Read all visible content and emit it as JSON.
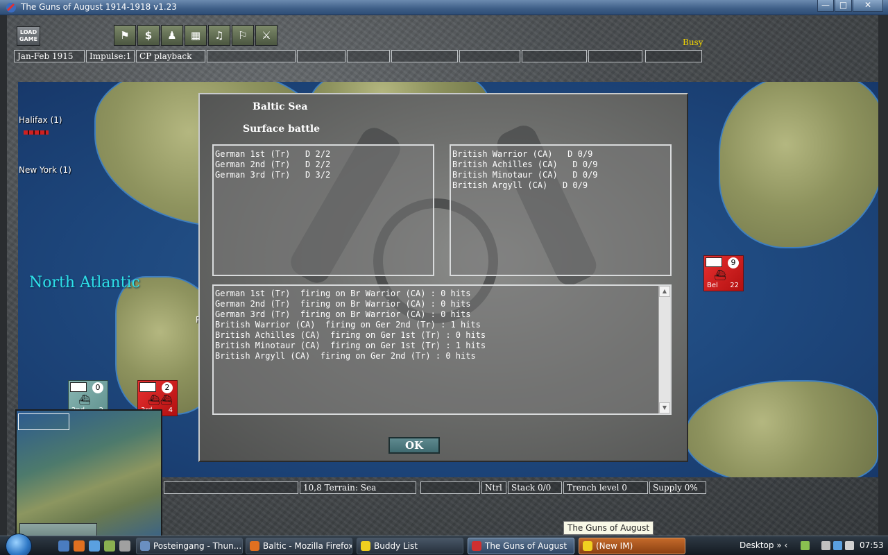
{
  "window": {
    "title": "The Guns of August 1914-1918  v1.23",
    "min_label": "—",
    "max_label": "□",
    "close_label": "✕"
  },
  "toolbar": {
    "load_game_label": "LOAD GAME",
    "tools": [
      {
        "icon": "map-flag-icon",
        "glyph": "⚑"
      },
      {
        "icon": "dollar-icon",
        "glyph": "$"
      },
      {
        "icon": "soldier-icon",
        "glyph": "♟"
      },
      {
        "icon": "map-icon",
        "glyph": "▦"
      },
      {
        "icon": "gramophone-icon",
        "glyph": "♫"
      },
      {
        "icon": "flag-icon",
        "glyph": "⚐"
      },
      {
        "icon": "troops-icon",
        "glyph": "⚔"
      }
    ],
    "busy": "Busy"
  },
  "status": {
    "date": "Jan-Feb 1915",
    "impulse": "Impulse:1",
    "phase": "CP playback",
    "empty": ""
  },
  "map": {
    "cities": [
      "Halifax (1)",
      "New York (1)"
    ],
    "ocean": "North Atlantic",
    "partial_label": "Ph",
    "units": [
      {
        "id": "british-fleet-right",
        "number": "9",
        "label": "Bel",
        "strength": "22"
      },
      {
        "id": "german-fleet",
        "number": "0",
        "label": "2nd",
        "strength": "2"
      },
      {
        "id": "british-fleet-left",
        "number": "2",
        "label": "3rd",
        "strength": "4"
      }
    ]
  },
  "dialog": {
    "title": "Baltic Sea",
    "subtitle": "Surface battle",
    "german_units": [
      "German 1st (Tr)   D 2/2",
      "German 2nd (Tr)   D 2/2",
      "German 3rd (Tr)   D 3/2"
    ],
    "british_units": [
      "British Warrior (CA)   D 0/9",
      "British Achilles (CA)   D 0/9",
      "British Minotaur (CA)   D 0/9",
      "British Argyll (CA)   D 0/9"
    ],
    "log": [
      "German 1st (Tr)  firing on Br Warrior (CA) : 0 hits",
      "German 2nd (Tr)  firing on Br Warrior (CA) : 0 hits",
      "German 3rd (Tr)  firing on Br Warrior (CA) : 0 hits",
      "British Warrior (CA)  firing on Ger 2nd (Tr) : 1 hits",
      "British Achilles (CA)  firing on Ger 1st (Tr) : 0 hits",
      "British Minotaur (CA)  firing on Ger 1st (Tr) : 1 hits",
      "British Argyll (CA)  firing on Ger 2nd (Tr) : 0 hits"
    ],
    "ok_label": "OK"
  },
  "bottom_status": {
    "coords": "10,8  Terrain: Sea",
    "nation": "Ntrl",
    "stack": "Stack 0/0",
    "trench": "Trench level 0",
    "supply": "Supply 0%"
  },
  "tooltip": "The Guns of August",
  "taskbar": {
    "tasks": [
      {
        "label": "Posteingang - Thun...",
        "icon_color": "#6a8fc0"
      },
      {
        "label": "Baltic - Mozilla Firefox",
        "icon_color": "#e07020"
      },
      {
        "label": "Buddy List",
        "icon_color": "#f0d020"
      },
      {
        "label": "The Guns of August",
        "icon_color": "#d03030"
      },
      {
        "label": "(New IM)",
        "icon_color": "#f0d020"
      }
    ],
    "desktop": "Desktop",
    "tray_chevrons": "»  ‹",
    "clock": "07:53"
  },
  "colors": {
    "busy": "#f5d800",
    "ocean_label": "#2ee0e8",
    "british_unit": "#d02020",
    "german_unit": "#7aa8a5"
  }
}
